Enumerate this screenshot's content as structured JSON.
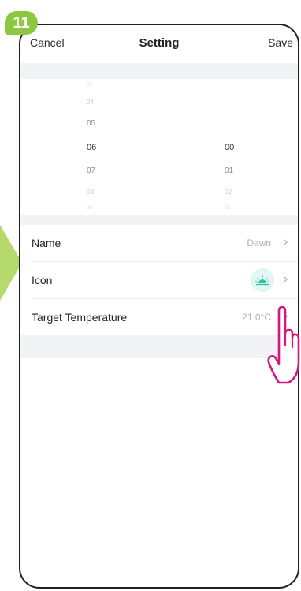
{
  "step_badge": "11",
  "header": {
    "cancel_label": "Cancel",
    "title": "Setting",
    "save_label": "Save"
  },
  "time_picker": {
    "hours": [
      "03",
      "04",
      "05",
      "06",
      "07",
      "08",
      "09"
    ],
    "selected_hour": "06",
    "minutes": [
      "00",
      "01",
      "02",
      "03"
    ],
    "selected_minute": "00"
  },
  "settings": {
    "name_label": "Name",
    "name_value": "Dawn",
    "icon_label": "Icon",
    "icon_name": "sunrise-icon",
    "target_temp_label": "Target Temperature",
    "target_temp_value": "21.0°C"
  },
  "colors": {
    "badge": "#8dc63f",
    "pointer": "#b6d96c",
    "hand": "#d6157f",
    "icon_accent": "#35c2a8",
    "icon_bg": "#e2f6f3"
  }
}
